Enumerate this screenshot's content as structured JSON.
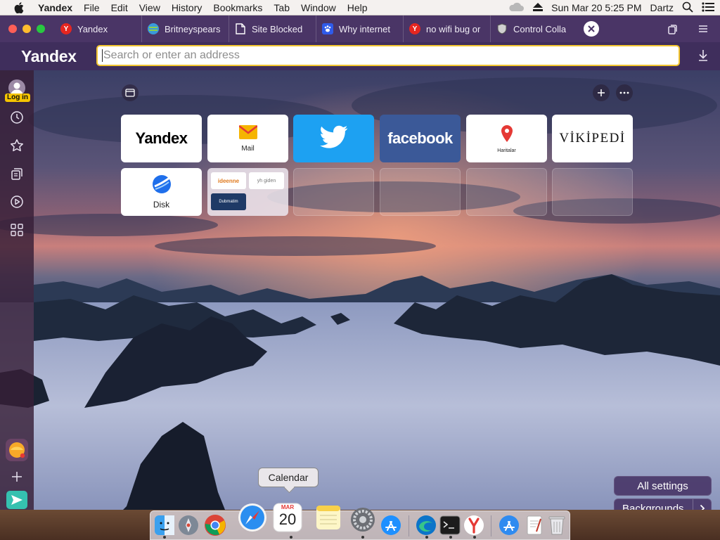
{
  "menubar": {
    "app_name": "Yandex",
    "items": [
      "File",
      "Edit",
      "View",
      "History",
      "Bookmarks",
      "Tab",
      "Window",
      "Help"
    ],
    "clock": "Sun Mar 20  5:25 PM",
    "user": "Dartz"
  },
  "tabs": [
    {
      "label": "Yandex",
      "icon": "yandex-icon",
      "color": "#e52620"
    },
    {
      "label": "Britneyspears",
      "icon": "globe-icon",
      "color": "#3a9ad9"
    },
    {
      "label": "Site Blocked",
      "icon": "document-icon",
      "color": "#ffffff"
    },
    {
      "label": "Why internet",
      "icon": "paw-icon",
      "color": "#2f5bea"
    },
    {
      "label": "no wifi bug or",
      "icon": "yandex-icon",
      "color": "#e52620"
    },
    {
      "label": "Control Colla",
      "icon": "shield-icon",
      "color": "#cccccc"
    }
  ],
  "address_bar": {
    "brand": "Yandex",
    "placeholder": "Search or enter an address",
    "value": ""
  },
  "sidebar": {
    "login_label": "Log in"
  },
  "tiles": [
    {
      "type": "logo",
      "text": "Yandex"
    },
    {
      "type": "mail",
      "caption": "Mail"
    },
    {
      "type": "twitter",
      "color": "#1da1f2"
    },
    {
      "type": "facebook",
      "text": "facebook",
      "color": "#3b5998"
    },
    {
      "type": "maps",
      "caption": "Haritalar"
    },
    {
      "type": "wiki",
      "text": "VİKİPEDİ"
    },
    {
      "type": "disk",
      "caption": "Disk"
    },
    {
      "type": "folder",
      "items": [
        "ideenne",
        "yh giden",
        "Dubmatim"
      ]
    }
  ],
  "buttons": {
    "all_settings": "All settings",
    "backgrounds": "Backgrounds"
  },
  "dock": {
    "tooltip": "Calendar",
    "calendar_month": "MAR",
    "calendar_day": "20",
    "apps": [
      "finder",
      "launchpad",
      "chrome",
      "safari",
      "calendar",
      "notes",
      "system-preferences",
      "app-store",
      "edge",
      "terminal",
      "yandex",
      "app-store",
      "textedit",
      "trash"
    ]
  }
}
